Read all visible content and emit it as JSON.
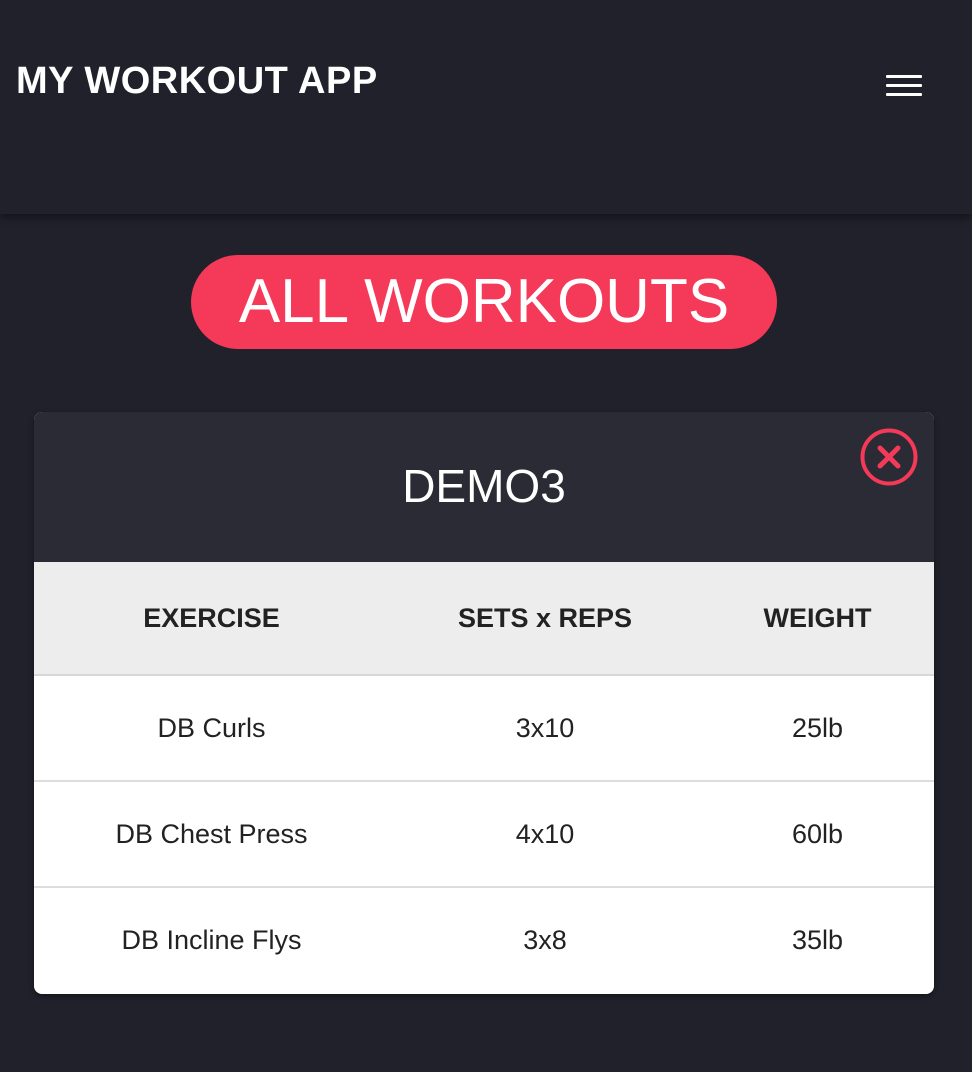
{
  "app": {
    "title": "MY WORKOUT APP",
    "menu_icon": "hamburger-menu-icon"
  },
  "page": {
    "all_workouts_label": "ALL WORKOUTS"
  },
  "workout": {
    "name": "DEMO3",
    "close_icon": "close-circle-icon",
    "columns": [
      "EXERCISE",
      "SETS x REPS",
      "WEIGHT"
    ],
    "rows": [
      {
        "exercise": "DB Curls",
        "sets_reps": "3x10",
        "weight": "25lb"
      },
      {
        "exercise": "DB Chest Press",
        "sets_reps": "4x10",
        "weight": "60lb"
      },
      {
        "exercise": "DB Incline Flys",
        "sets_reps": "3x8",
        "weight": "35lb"
      }
    ]
  },
  "colors": {
    "background": "#20212a",
    "card_header": "#2a2b35",
    "accent": "#f43a58",
    "table_header": "#ededed",
    "text_dark": "#222222"
  }
}
